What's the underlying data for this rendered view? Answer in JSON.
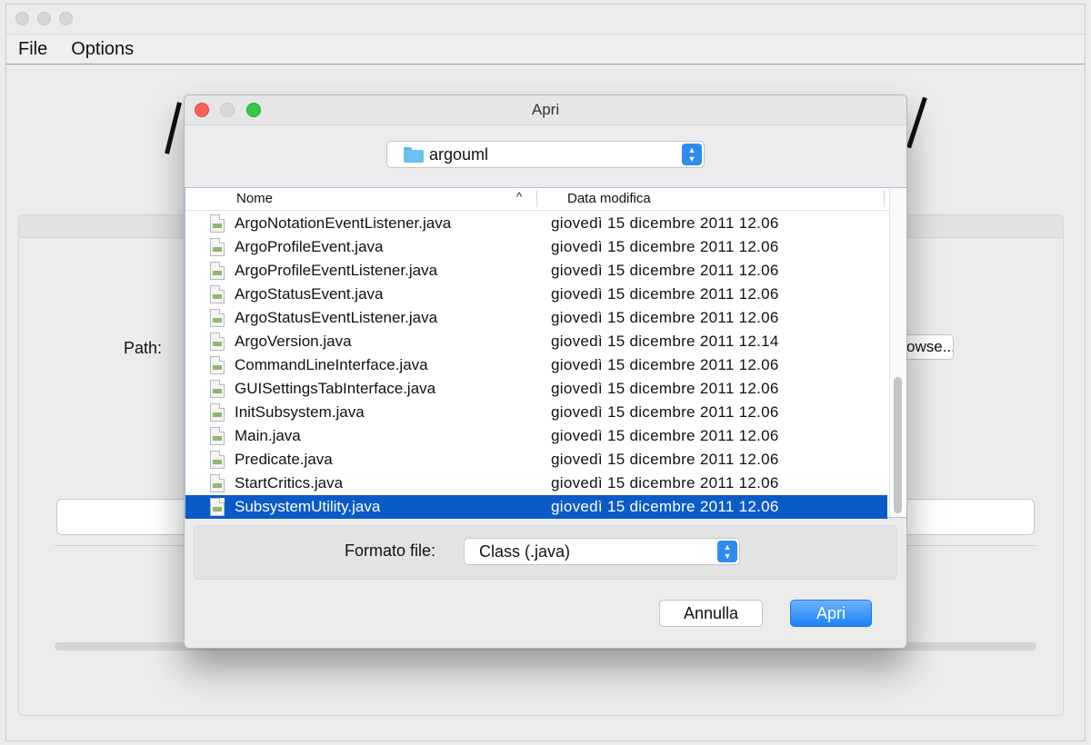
{
  "main": {
    "menu": [
      "File",
      "Options"
    ],
    "path_label": "Path:",
    "browse_label": "Browse..."
  },
  "dialog": {
    "title": "Apri",
    "folder": "argouml",
    "columns": {
      "name": "Nome",
      "date": "Data modifica"
    },
    "files": [
      {
        "name": "ArgoNotationEventListener.java",
        "date": "giovedì 15 dicembre 2011 12.06"
      },
      {
        "name": "ArgoProfileEvent.java",
        "date": "giovedì 15 dicembre 2011 12.06"
      },
      {
        "name": "ArgoProfileEventListener.java",
        "date": "giovedì 15 dicembre 2011 12.06"
      },
      {
        "name": "ArgoStatusEvent.java",
        "date": "giovedì 15 dicembre 2011 12.06"
      },
      {
        "name": "ArgoStatusEventListener.java",
        "date": "giovedì 15 dicembre 2011 12.06"
      },
      {
        "name": "ArgoVersion.java",
        "date": "giovedì 15 dicembre 2011 12.14"
      },
      {
        "name": "CommandLineInterface.java",
        "date": "giovedì 15 dicembre 2011 12.06"
      },
      {
        "name": "GUISettingsTabInterface.java",
        "date": "giovedì 15 dicembre 2011 12.06"
      },
      {
        "name": "InitSubsystem.java",
        "date": "giovedì 15 dicembre 2011 12.06"
      },
      {
        "name": "Main.java",
        "date": "giovedì 15 dicembre 2011 12.06"
      },
      {
        "name": "Predicate.java",
        "date": "giovedì 15 dicembre 2011 12.06"
      },
      {
        "name": "StartCritics.java",
        "date": "giovedì 15 dicembre 2011 12.06"
      },
      {
        "name": "SubsystemUtility.java",
        "date": "giovedì 15 dicembre 2011 12.06",
        "selected": true
      }
    ],
    "format_label": "Formato file:",
    "format_value": "Class (.java)",
    "cancel_label": "Annulla",
    "open_label": "Apri"
  },
  "colors": {
    "selection": "#0a5bc8",
    "primary_button": "#1a82fb",
    "close_dot": "#fc5f57",
    "min_dot": "#d8d8d8",
    "zoom_dot": "#34c84a"
  }
}
